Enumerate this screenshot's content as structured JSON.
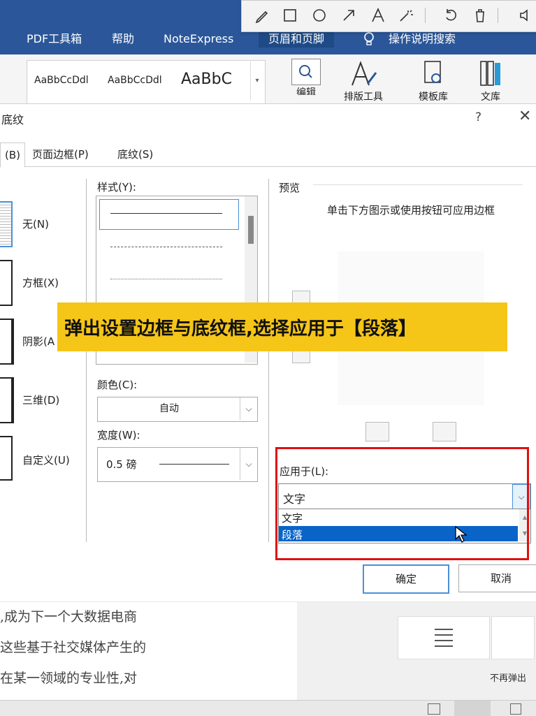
{
  "ribbon": {
    "tabs": [
      "PDF工具箱",
      "帮助",
      "NoteExpress",
      "页眉和页脚",
      "操作说明搜索"
    ],
    "active_tab": "页眉和页脚",
    "styles": [
      "AaBbCcDdl",
      "AaBbCcDdl",
      "AaBbC"
    ],
    "buttons": [
      "编辑",
      "排版工具",
      "模板库",
      "文库"
    ]
  },
  "dialog": {
    "title": "底纹",
    "help": "?",
    "close": "✕",
    "tabs": [
      "(B)",
      "页面边框(P)",
      "底纹(S)"
    ],
    "settings": [
      "无(N)",
      "方框(X)",
      "阴影(A",
      "三维(D)",
      "自定义(U)"
    ],
    "style_label": "样式(Y):",
    "color_label": "颜色(C):",
    "color_value": "自动",
    "width_label": "宽度(W):",
    "width_value": "0.5 磅",
    "preview_label": "预览",
    "preview_hint": "单击下方图示或使用按钮可应用边框",
    "apply_label": "应用于(L):",
    "apply_value": "文字",
    "apply_options": [
      "文字",
      "段落"
    ],
    "apply_selected": "段落",
    "ok": "确定",
    "cancel": "取消"
  },
  "overlay": {
    "caption": "弹出设置边框与底纹框,选择应用于【段落】",
    "caption_bg": "#f5c518"
  },
  "document": {
    "lines": [
      ",成为下一个大数据电商",
      "这些基于社交媒体产生的",
      "在某一领域的专业性,对"
    ]
  },
  "side_panel": {
    "text": "不再弹出"
  },
  "colors": {
    "ribbon_blue": "#2b579a",
    "selection_blue": "#0a64c8",
    "highlight_red": "#e01010"
  }
}
